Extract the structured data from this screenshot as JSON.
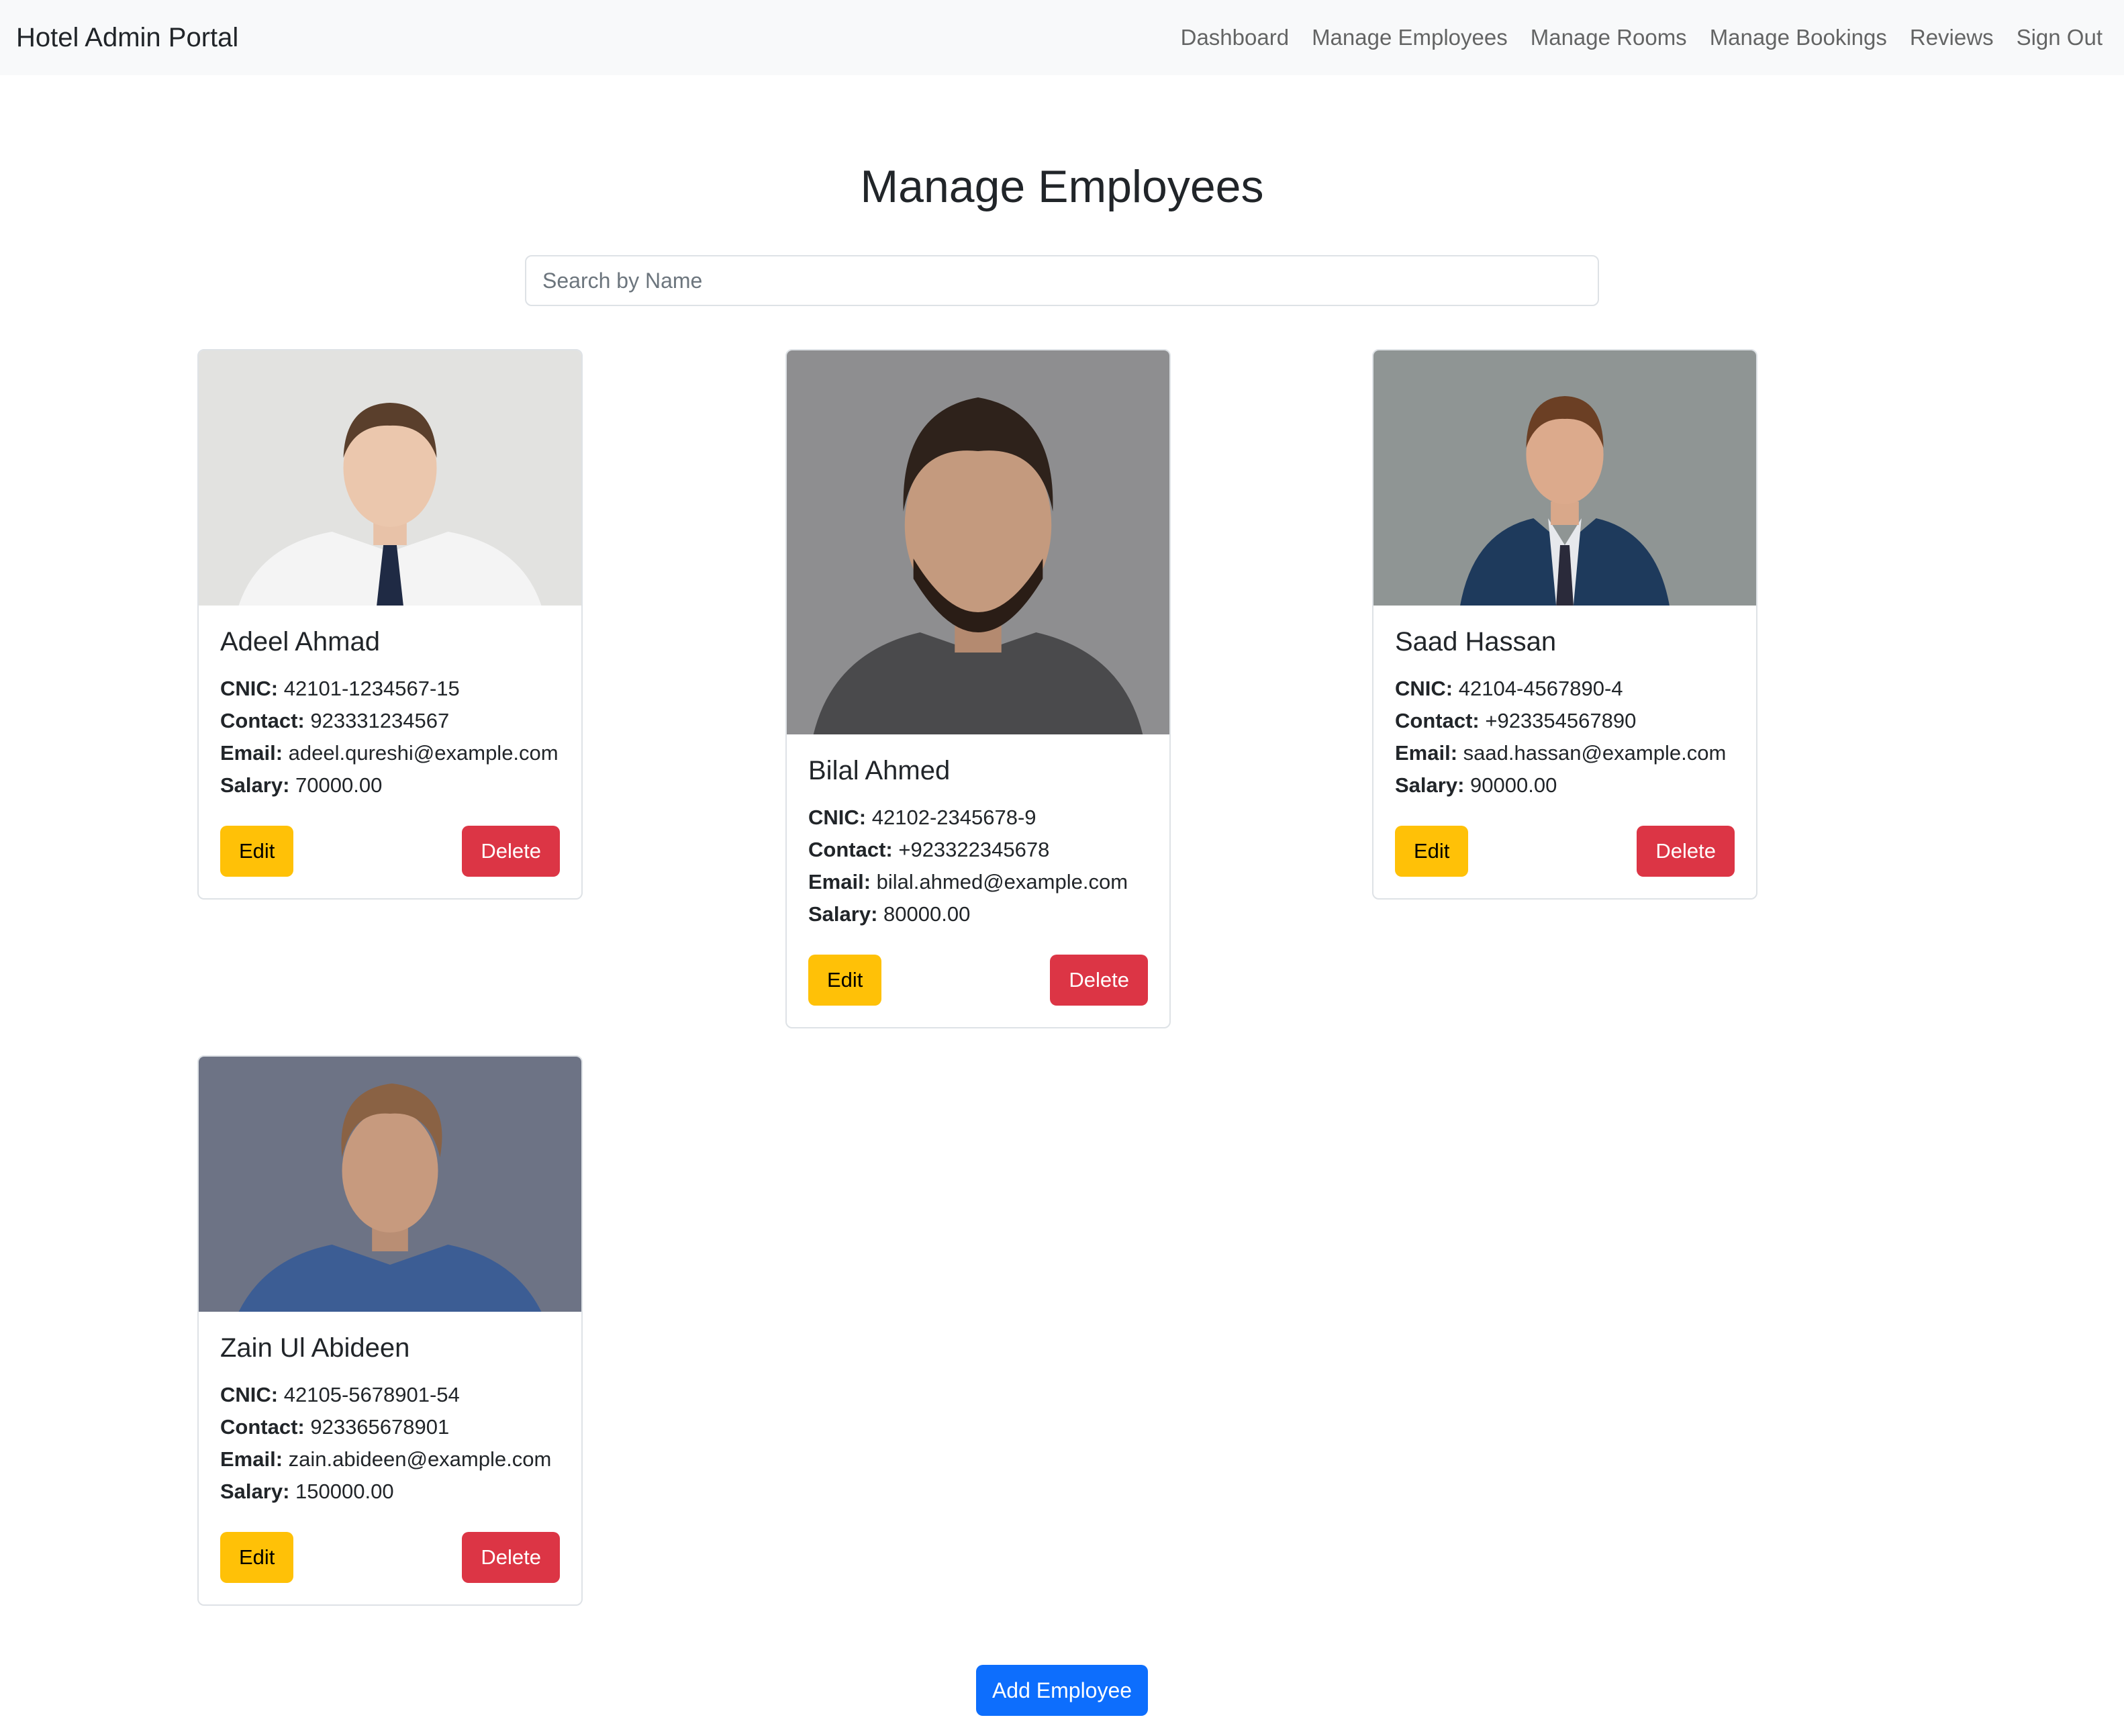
{
  "navbar": {
    "brand": "Hotel Admin Portal",
    "links": [
      "Dashboard",
      "Manage Employees",
      "Manage Rooms",
      "Manage Bookings",
      "Reviews",
      "Sign Out"
    ]
  },
  "page": {
    "title": "Manage Employees",
    "search_placeholder": "Search by Name",
    "add_button": "Add Employee"
  },
  "labels": {
    "cnic": "CNIC:",
    "contact": "Contact:",
    "email": "Email:",
    "salary": "Salary:",
    "edit": "Edit",
    "delete": "Delete"
  },
  "employees": [
    {
      "name": "Adeel Ahmad",
      "cnic": "42101-1234567-15",
      "contact": "923331234567",
      "email": "adeel.qureshi@example.com",
      "salary": "70000.00"
    },
    {
      "name": "Bilal Ahmed",
      "cnic": "42102-2345678-9",
      "contact": "+923322345678",
      "email": "bilal.ahmed@example.com",
      "salary": "80000.00"
    },
    {
      "name": "Saad Hassan",
      "cnic": "42104-4567890-4",
      "contact": "+923354567890",
      "email": "saad.hassan@example.com",
      "salary": "90000.00"
    },
    {
      "name": "Zain Ul Abideen",
      "cnic": "42105-5678901-54",
      "contact": "923365678901",
      "email": "zain.abideen@example.com",
      "salary": "150000.00"
    }
  ],
  "colors": {
    "navbar_bg": "#f8f9fa",
    "edit": "#ffc107",
    "delete": "#dc3545",
    "primary": "#0d6efd"
  }
}
